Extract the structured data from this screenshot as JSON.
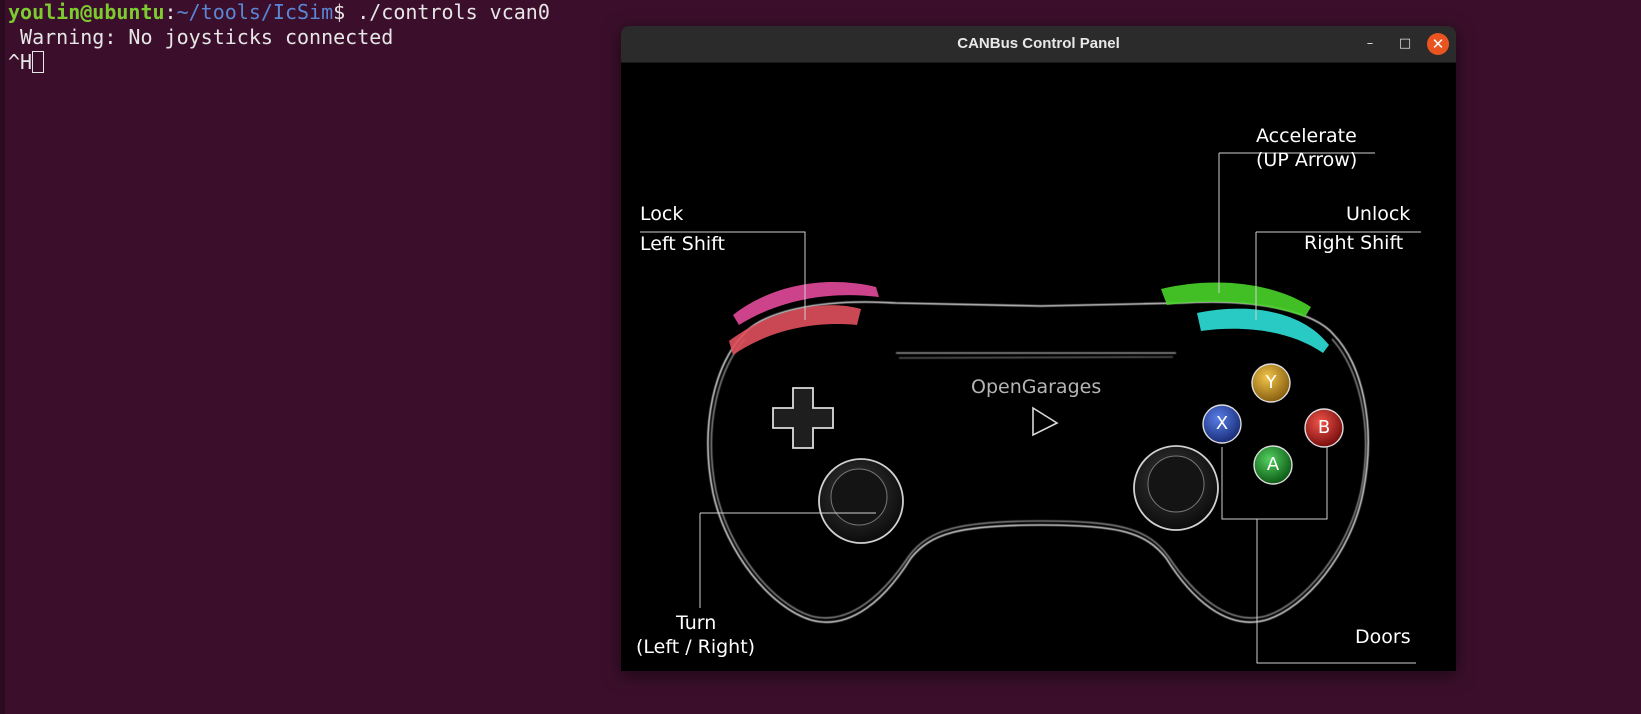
{
  "terminal": {
    "prompt_user": "youlin@ubuntu",
    "prompt_sep": ":",
    "prompt_path": "~/tools/IcSim",
    "prompt_dollar": "$",
    "command": " ./controls vcan0",
    "warning": " Warning: No joysticks connected",
    "input": "^H"
  },
  "window": {
    "title": "CANBus Control Panel",
    "minimize": "–",
    "maximize": "□",
    "close": "✕"
  },
  "panel": {
    "brand": "OpenGarages",
    "lock": "Lock",
    "lock_key": "Left Shift",
    "unlock": "Unlock",
    "unlock_key": "Right Shift",
    "accelerate": "Accelerate",
    "accelerate_key": "(UP Arrow)",
    "turn": "Turn",
    "turn_key": "(Left / Right)",
    "doors": "Doors",
    "buttons": {
      "y": "Y",
      "x": "X",
      "b": "B",
      "a": "A"
    }
  },
  "colors": {
    "background": "#3b0f2b",
    "prompt_user": "#7dcc2f",
    "prompt_path": "#5a86d3",
    "lock_bumper": "#e24a9a",
    "lock_trigger": "#e0505c",
    "unlock_bumper": "#4ad42a",
    "unlock_trigger": "#2ee0d8",
    "button_y": "#c8961a",
    "button_x": "#2d4fb8",
    "button_b": "#c81e1e",
    "button_a": "#1f9a2a",
    "close_button": "#e95420"
  }
}
